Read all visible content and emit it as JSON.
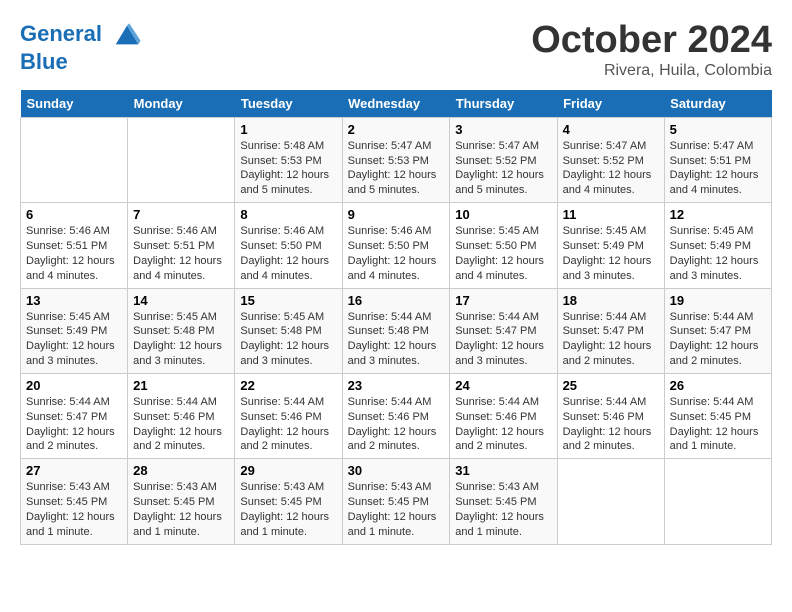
{
  "header": {
    "logo_line1": "General",
    "logo_line2": "Blue",
    "month": "October 2024",
    "location": "Rivera, Huila, Colombia"
  },
  "weekdays": [
    "Sunday",
    "Monday",
    "Tuesday",
    "Wednesday",
    "Thursday",
    "Friday",
    "Saturday"
  ],
  "weeks": [
    [
      {
        "day": "",
        "info": ""
      },
      {
        "day": "",
        "info": ""
      },
      {
        "day": "1",
        "info": "Sunrise: 5:48 AM\nSunset: 5:53 PM\nDaylight: 12 hours\nand 5 minutes."
      },
      {
        "day": "2",
        "info": "Sunrise: 5:47 AM\nSunset: 5:53 PM\nDaylight: 12 hours\nand 5 minutes."
      },
      {
        "day": "3",
        "info": "Sunrise: 5:47 AM\nSunset: 5:52 PM\nDaylight: 12 hours\nand 5 minutes."
      },
      {
        "day": "4",
        "info": "Sunrise: 5:47 AM\nSunset: 5:52 PM\nDaylight: 12 hours\nand 4 minutes."
      },
      {
        "day": "5",
        "info": "Sunrise: 5:47 AM\nSunset: 5:51 PM\nDaylight: 12 hours\nand 4 minutes."
      }
    ],
    [
      {
        "day": "6",
        "info": "Sunrise: 5:46 AM\nSunset: 5:51 PM\nDaylight: 12 hours\nand 4 minutes."
      },
      {
        "day": "7",
        "info": "Sunrise: 5:46 AM\nSunset: 5:51 PM\nDaylight: 12 hours\nand 4 minutes."
      },
      {
        "day": "8",
        "info": "Sunrise: 5:46 AM\nSunset: 5:50 PM\nDaylight: 12 hours\nand 4 minutes."
      },
      {
        "day": "9",
        "info": "Sunrise: 5:46 AM\nSunset: 5:50 PM\nDaylight: 12 hours\nand 4 minutes."
      },
      {
        "day": "10",
        "info": "Sunrise: 5:45 AM\nSunset: 5:50 PM\nDaylight: 12 hours\nand 4 minutes."
      },
      {
        "day": "11",
        "info": "Sunrise: 5:45 AM\nSunset: 5:49 PM\nDaylight: 12 hours\nand 3 minutes."
      },
      {
        "day": "12",
        "info": "Sunrise: 5:45 AM\nSunset: 5:49 PM\nDaylight: 12 hours\nand 3 minutes."
      }
    ],
    [
      {
        "day": "13",
        "info": "Sunrise: 5:45 AM\nSunset: 5:49 PM\nDaylight: 12 hours\nand 3 minutes."
      },
      {
        "day": "14",
        "info": "Sunrise: 5:45 AM\nSunset: 5:48 PM\nDaylight: 12 hours\nand 3 minutes."
      },
      {
        "day": "15",
        "info": "Sunrise: 5:45 AM\nSunset: 5:48 PM\nDaylight: 12 hours\nand 3 minutes."
      },
      {
        "day": "16",
        "info": "Sunrise: 5:44 AM\nSunset: 5:48 PM\nDaylight: 12 hours\nand 3 minutes."
      },
      {
        "day": "17",
        "info": "Sunrise: 5:44 AM\nSunset: 5:47 PM\nDaylight: 12 hours\nand 3 minutes."
      },
      {
        "day": "18",
        "info": "Sunrise: 5:44 AM\nSunset: 5:47 PM\nDaylight: 12 hours\nand 2 minutes."
      },
      {
        "day": "19",
        "info": "Sunrise: 5:44 AM\nSunset: 5:47 PM\nDaylight: 12 hours\nand 2 minutes."
      }
    ],
    [
      {
        "day": "20",
        "info": "Sunrise: 5:44 AM\nSunset: 5:47 PM\nDaylight: 12 hours\nand 2 minutes."
      },
      {
        "day": "21",
        "info": "Sunrise: 5:44 AM\nSunset: 5:46 PM\nDaylight: 12 hours\nand 2 minutes."
      },
      {
        "day": "22",
        "info": "Sunrise: 5:44 AM\nSunset: 5:46 PM\nDaylight: 12 hours\nand 2 minutes."
      },
      {
        "day": "23",
        "info": "Sunrise: 5:44 AM\nSunset: 5:46 PM\nDaylight: 12 hours\nand 2 minutes."
      },
      {
        "day": "24",
        "info": "Sunrise: 5:44 AM\nSunset: 5:46 PM\nDaylight: 12 hours\nand 2 minutes."
      },
      {
        "day": "25",
        "info": "Sunrise: 5:44 AM\nSunset: 5:46 PM\nDaylight: 12 hours\nand 2 minutes."
      },
      {
        "day": "26",
        "info": "Sunrise: 5:44 AM\nSunset: 5:45 PM\nDaylight: 12 hours\nand 1 minute."
      }
    ],
    [
      {
        "day": "27",
        "info": "Sunrise: 5:43 AM\nSunset: 5:45 PM\nDaylight: 12 hours\nand 1 minute."
      },
      {
        "day": "28",
        "info": "Sunrise: 5:43 AM\nSunset: 5:45 PM\nDaylight: 12 hours\nand 1 minute."
      },
      {
        "day": "29",
        "info": "Sunrise: 5:43 AM\nSunset: 5:45 PM\nDaylight: 12 hours\nand 1 minute."
      },
      {
        "day": "30",
        "info": "Sunrise: 5:43 AM\nSunset: 5:45 PM\nDaylight: 12 hours\nand 1 minute."
      },
      {
        "day": "31",
        "info": "Sunrise: 5:43 AM\nSunset: 5:45 PM\nDaylight: 12 hours\nand 1 minute."
      },
      {
        "day": "",
        "info": ""
      },
      {
        "day": "",
        "info": ""
      }
    ]
  ]
}
